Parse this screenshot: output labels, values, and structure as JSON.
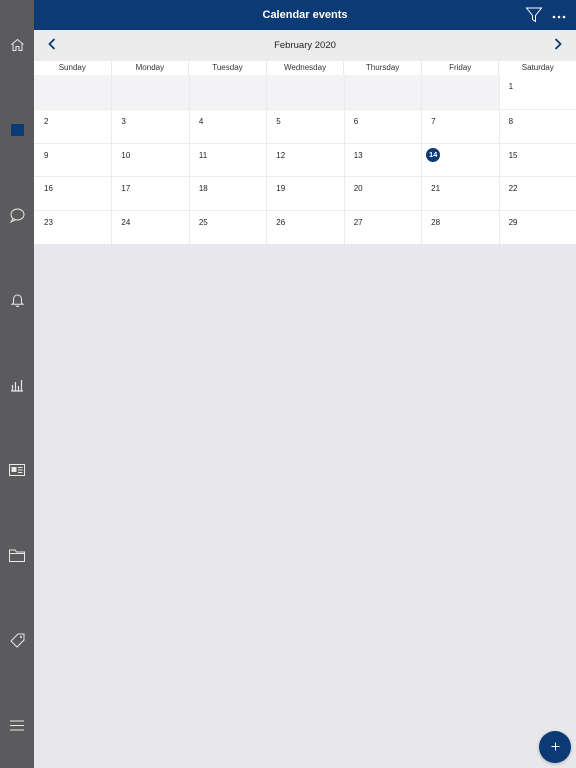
{
  "header": {
    "title": "Calendar events",
    "icons": [
      "filter-icon",
      "more-icon"
    ]
  },
  "sidebar": {
    "items": [
      {
        "name": "home",
        "icon": "home-icon"
      },
      {
        "name": "calendar",
        "icon": "calendar-icon",
        "active": true
      },
      {
        "name": "chat",
        "icon": "chat-icon"
      },
      {
        "name": "notifications",
        "icon": "bell-icon"
      },
      {
        "name": "reports",
        "icon": "chart-icon"
      },
      {
        "name": "news",
        "icon": "newspaper-icon"
      },
      {
        "name": "files",
        "icon": "folder-icon"
      },
      {
        "name": "tags",
        "icon": "tag-icon"
      },
      {
        "name": "menu",
        "icon": "hamburger-icon"
      }
    ]
  },
  "calendar": {
    "month_label": "February 2020",
    "weekdays": [
      "Sunday",
      "Monday",
      "Tuesday",
      "Wednesday",
      "Thursday",
      "Friday",
      "Saturday"
    ],
    "weeks": [
      [
        "",
        "",
        "",
        "",
        "",
        "",
        "1"
      ],
      [
        "2",
        "3",
        "4",
        "5",
        "6",
        "7",
        "8"
      ],
      [
        "9",
        "10",
        "11",
        "12",
        "13",
        "14",
        "15"
      ],
      [
        "16",
        "17",
        "18",
        "19",
        "20",
        "21",
        "22"
      ],
      [
        "23",
        "24",
        "25",
        "26",
        "27",
        "28",
        "29"
      ]
    ],
    "today": "14"
  },
  "fab": {
    "label": "+"
  },
  "colors": {
    "primary": "#0b3a75",
    "sidebar": "#5b5b5d",
    "background": "#e8e8ec"
  }
}
